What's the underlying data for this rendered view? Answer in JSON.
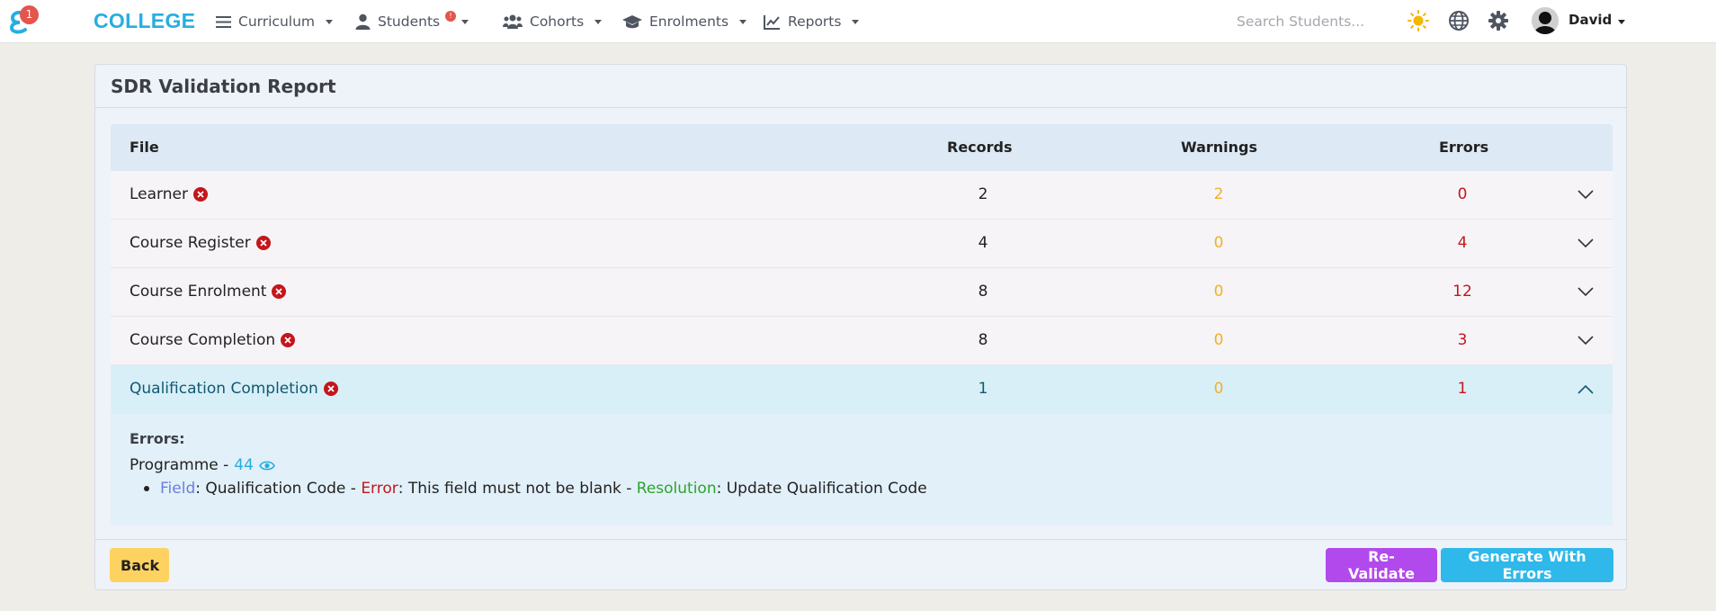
{
  "nav": {
    "logo_badge": "1",
    "brand": "COLLEGE",
    "items": [
      {
        "label": "Curriculum",
        "icon": "menu-icon"
      },
      {
        "label": "Students",
        "icon": "user-icon",
        "badge": "!"
      },
      {
        "label": "Cohorts",
        "icon": "users-icon"
      },
      {
        "label": "Enrolments",
        "icon": "graduation-cap-icon"
      },
      {
        "label": "Reports",
        "icon": "chart-line-icon"
      }
    ],
    "search_placeholder": "Search Students...",
    "user_name": "David"
  },
  "card": {
    "title": "SDR Validation Report",
    "columns": {
      "file": "File",
      "records": "Records",
      "warnings": "Warnings",
      "errors": "Errors"
    },
    "rows": [
      {
        "file": "Learner",
        "records": "2",
        "warnings": "2",
        "errors": "0",
        "expanded": false
      },
      {
        "file": "Course Register",
        "records": "4",
        "warnings": "0",
        "errors": "4",
        "expanded": false
      },
      {
        "file": "Course Enrolment",
        "records": "8",
        "warnings": "0",
        "errors": "12",
        "expanded": false
      },
      {
        "file": "Course Completion",
        "records": "8",
        "warnings": "0",
        "errors": "3",
        "expanded": false
      },
      {
        "file": "Qualification Completion",
        "records": "1",
        "warnings": "0",
        "errors": "1",
        "expanded": true
      }
    ],
    "detail": {
      "errors_label": "Errors:",
      "programme_label": "Programme - ",
      "programme_id": "44",
      "field_label": "Field",
      "field_value": ": Qualification Code - ",
      "error_label": "Error",
      "error_value": ": This field must not be blank - ",
      "resolution_label": "Resolution",
      "resolution_value": ": Update Qualification Code"
    },
    "buttons": {
      "back": "Back",
      "revalidate": "Re-Validate",
      "generate": "Generate With Errors"
    }
  },
  "colors": {
    "accent": "#26aee0",
    "error": "#c4161c",
    "warning": "#f3b023",
    "purple": "#b249ec",
    "yellow": "#fdd261"
  }
}
